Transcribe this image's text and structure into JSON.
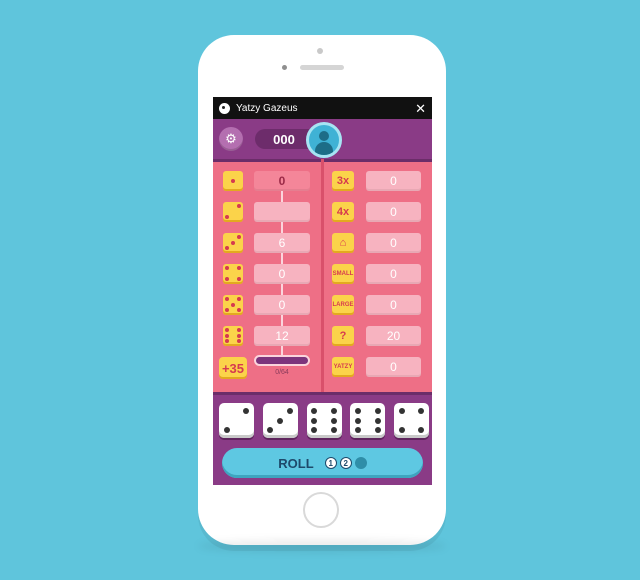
{
  "app": {
    "title": "Yatzy Gazeus"
  },
  "header": {
    "score": "000"
  },
  "upper": [
    {
      "face": 1,
      "value": "0",
      "filled": true
    },
    {
      "face": 2,
      "value": "",
      "filled": false
    },
    {
      "face": 3,
      "value": "6",
      "filled": false
    },
    {
      "face": 4,
      "value": "0",
      "filled": false
    },
    {
      "face": 5,
      "value": "0",
      "filled": false
    },
    {
      "face": 6,
      "value": "12",
      "filled": false
    }
  ],
  "bonus": {
    "label": "+35",
    "progress": "0/64"
  },
  "lower": [
    {
      "icon": "three-of-a-kind-icon",
      "label": "3x",
      "value": "0"
    },
    {
      "icon": "four-of-a-kind-icon",
      "label": "4x",
      "value": "0"
    },
    {
      "icon": "full-house-icon",
      "label": "⌂",
      "value": "0"
    },
    {
      "icon": "small-straight-icon",
      "label": "SMALL",
      "value": "0"
    },
    {
      "icon": "large-straight-icon",
      "label": "LARGE",
      "value": "0"
    },
    {
      "icon": "chance-icon",
      "label": "?",
      "value": "20"
    },
    {
      "icon": "yatzy-icon",
      "label": "YATZY",
      "value": "0"
    }
  ],
  "dice": [
    2,
    3,
    6,
    6,
    4
  ],
  "roll": {
    "label": "ROLL",
    "counts": [
      "1",
      "2",
      ""
    ]
  },
  "colors": {
    "background": "#5fc5dc",
    "board": "#ee6f86",
    "tray": "#8a3b86",
    "accent": "#fbd34a"
  }
}
